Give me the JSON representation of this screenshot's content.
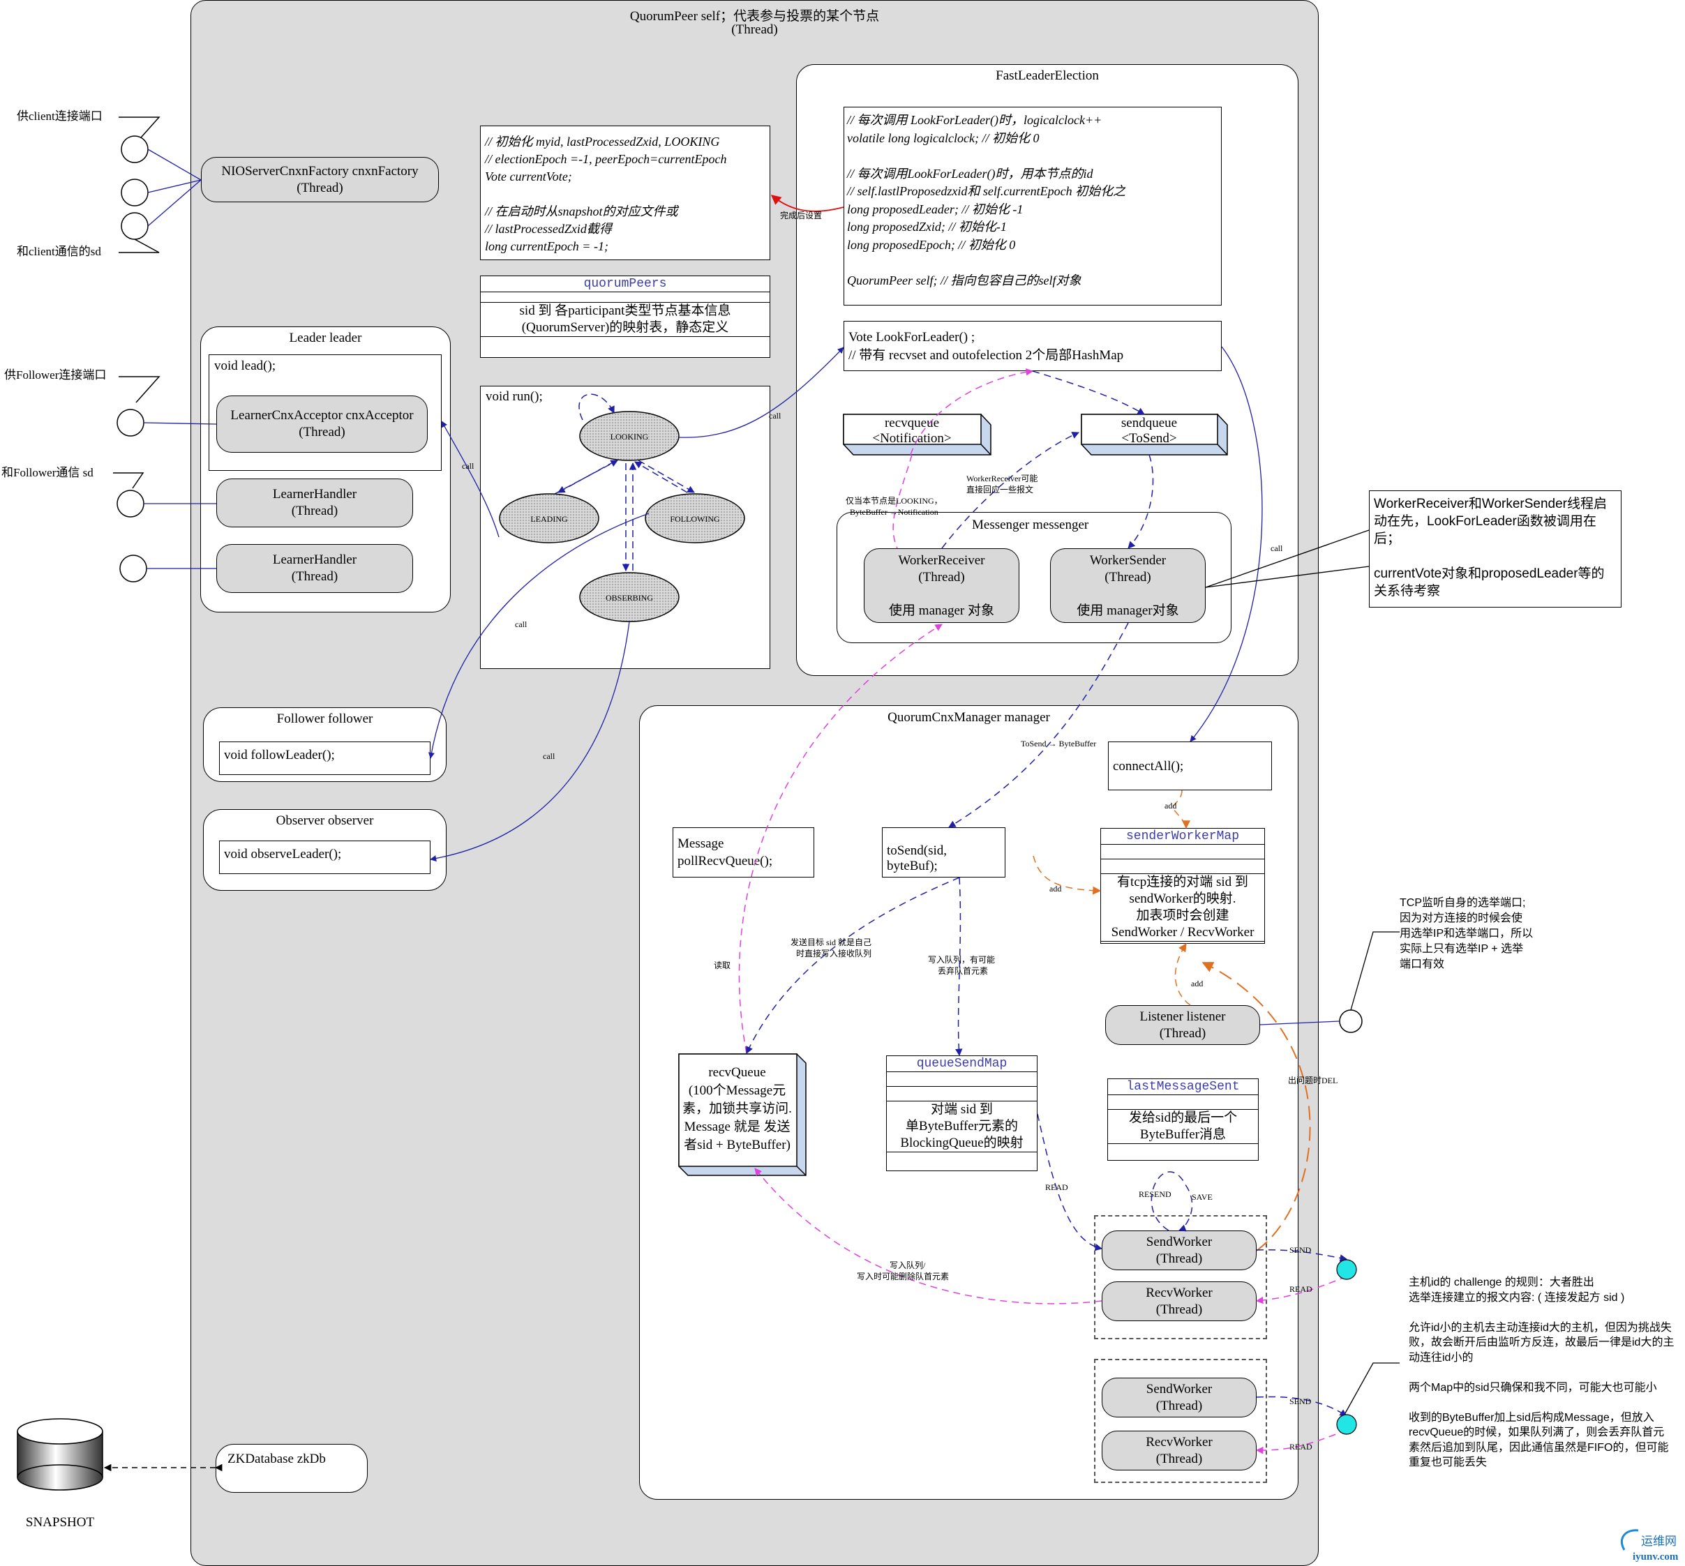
{
  "quorum_peer": {
    "title": "QuorumPeer self；代表参与投票的某个节点",
    "subtitle": "(Thread)"
  },
  "left_ports": {
    "client_port": "供client连接端口",
    "client_sd": "和client通信的sd",
    "follower_port": "供Follower连接端口",
    "follower_sd": "和Follower通信 sd"
  },
  "nio_factory": "NIOServerCnxnFactory cnxnFactory\n(Thread)",
  "init_box": {
    "lines": "// 初始化 myid, lastProcessedZxid, LOOKING\n// electionEpoch =-1, peerEpoch=currentEpoch\nVote currentVote;\n\n// 在启动时从snapshot的对应文件或\n// lastProcessedZxid截得\nlong currentEpoch = -1;"
  },
  "quorum_peers": {
    "title": "quorumPeers",
    "desc": "sid 到 各participant类型节点基本信息\n(QuorumServer)的映射表，静态定义"
  },
  "leader": {
    "title": "Leader leader",
    "method": "void lead();",
    "acceptor": "LearnerCnxAcceptor cnxAcceptor\n(Thread)",
    "handler1": "LearnerHandler\n(Thread)",
    "handler2": "LearnerHandler\n(Thread)"
  },
  "run": {
    "title": "void run();",
    "states": [
      "LOOKING",
      "LEADING",
      "FOLLOWING",
      "OBSERBING"
    ]
  },
  "follower": {
    "title": "Follower follower",
    "method": "void followLeader();"
  },
  "observer": {
    "title": "Observer observer",
    "method": "void observeLeader();"
  },
  "zkdb": "ZKDatabase zkDb",
  "snapshot": "SNAPSHOT",
  "fle": {
    "title": "FastLeaderElection",
    "fields": "// 每次调用 LookForLeader()时，logicalclock++\nvolatile long logicalclock; //  初始化 0\n\n// 每次调用LookForLeader()时，用本节点的id\n// self.lastlProposedzxid和 self.currentEpoch 初始化之\nlong proposedLeader;        // 初始化 -1\nlong proposedZxid;           // 初始化-1\nlong proposedEpoch;         // 初始化 0\n\nQuorumPeer self;             // 指向包容自己的self对象",
    "lookfor": "Vote LookForLeader() ;\n// 带有 recvset  and outofelection 2个局部HashMap",
    "recvqueue": "recvqueue\n<Notification>",
    "sendqueue": "sendqueue\n<ToSend>",
    "messenger": "Messenger messenger",
    "worker_receiver": "WorkerReceiver\n(Thread)\n\n使用 manager 对象",
    "worker_sender": "WorkerSender\n(Thread)\n\n使用 manager对象"
  },
  "fle_labels": {
    "set_after_done": "完成后设置",
    "only_looking": "仅当本节点是LOOKING，\nByteBuffer→Notification",
    "worker_reply": "WorkerReceiver可能\n直接回应一些报文",
    "call": "call",
    "to_send_bytebuffer": "ToSend → ByteBuffer"
  },
  "right_note": "WorkerReceiver和WorkerSender线程启动在先，LookForLeader函数被调用在后；\n\ncurrentVote对象和proposedLeader等的关系待考察",
  "cnx": {
    "title": "QuorumCnxManager  manager",
    "connect_all": "connectAll();",
    "sender_worker_map": {
      "title": "senderWorkerMap",
      "desc": "有tcp连接的对端 sid 到\nsendWorker的映射.\n加表项时会创建\nSendWorker / RecvWorker"
    },
    "poll": "Message\npollRecvQueue();",
    "to_send": "toSend(sid, byteBuf);",
    "recv_queue": "recvQueue\n(100个Message元\n素，加锁共享访问.\nMessage 就是 发送\n者sid + ByteBuffer)",
    "queue_send_map": {
      "title": "queueSendMap",
      "desc": "对端 sid 到\n单ByteBuffer元素的\nBlockingQueue的映射"
    },
    "last_msg": {
      "title": "lastMessageSent",
      "desc": "发给sid的最后一个\nByteBuffer消息"
    },
    "listener": "Listener listener\n(Thread)",
    "send_worker": "SendWorker\n(Thread)",
    "recv_worker": "RecvWorker\n(Thread)"
  },
  "cnx_labels": {
    "add": "add",
    "read_label": "读取",
    "self_target": "发送目标 sid 就是自己\n时直接写入接收队列",
    "write_queue": "写入队列，有可能\n丢弃队首元素",
    "write_queue2": "写入队列/\n写入时可能删除队首元素",
    "read": "READ",
    "resend": "RESEND",
    "save": "SAVE",
    "send": "SEND",
    "del": "出问题时DEL"
  },
  "tcp_note": "TCP监听自身的选举端口;\n因为对方连接的时候会使\n用选举IP和选举端口，所以\n实际上只有选举IP + 选举\n端口有效",
  "bottom_note": "主机id的 challenge 的规则：大者胜出\n选举连接建立的报文内容: ( 连接发起方 sid )\n\n允许id小的主机去主动连接id大的主机，但因为挑战失\n败，故会断开后由监听方反连，故最后一律是id大的主\n动连往id小的\n\n两个Map中的sid只确保和我不同，可能大也可能小\n\n收到的ByteBuffer加上sid后构成Message，但放入\nrecvQueue的时候，如果队列满了，则会丢弃队首元\n素然后追加到队尾，因此通信虽然是FIFO的，但可能\n重复也可能丢失",
  "watermark": {
    "name": "运维网",
    "url": "iyunv.com"
  },
  "colors": {
    "panel": "#dcdcdc",
    "thread": "#d9d9d9",
    "blue": "#1f1fa8",
    "magenta": "#e040e0",
    "orange": "#e07020",
    "red": "#e01010",
    "cyan": "#22e6e6",
    "queue": "#c7d7ee"
  }
}
